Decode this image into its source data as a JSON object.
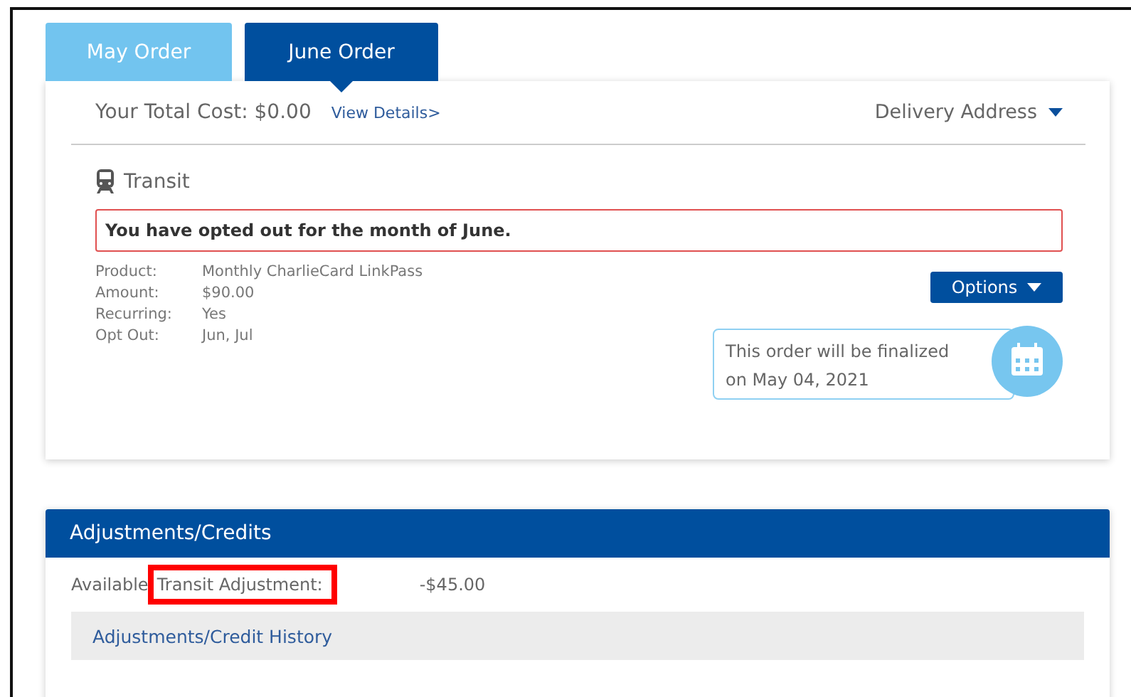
{
  "tabs": [
    {
      "label": "May Order",
      "selected": false
    },
    {
      "label": "June Order",
      "selected": true
    }
  ],
  "order": {
    "total_cost": "Your Total Cost: $0.00",
    "details_link": "View Details>",
    "delivery": "Delivery Address",
    "section": "Transit",
    "alert": "You have opted out for the month of June.",
    "details": [
      {
        "label": "Product:",
        "value": "Monthly CharlieCard LinkPass"
      },
      {
        "label": "Amount:",
        "value": "$90.00"
      },
      {
        "label": "Recurring:",
        "value": "Yes"
      },
      {
        "label": "Opt Out:",
        "value": "Jun, Jul"
      }
    ],
    "options_button": "Options",
    "finalize_note": "This order will be finalized on May 04, 2021"
  },
  "adjustments": {
    "title": "Adjustments/Credits",
    "prefix": "Available",
    "label": "Transit Adjustment:",
    "highlighted": true,
    "amount": "-$45.00",
    "history_link": "Adjustments/Credit History"
  }
}
